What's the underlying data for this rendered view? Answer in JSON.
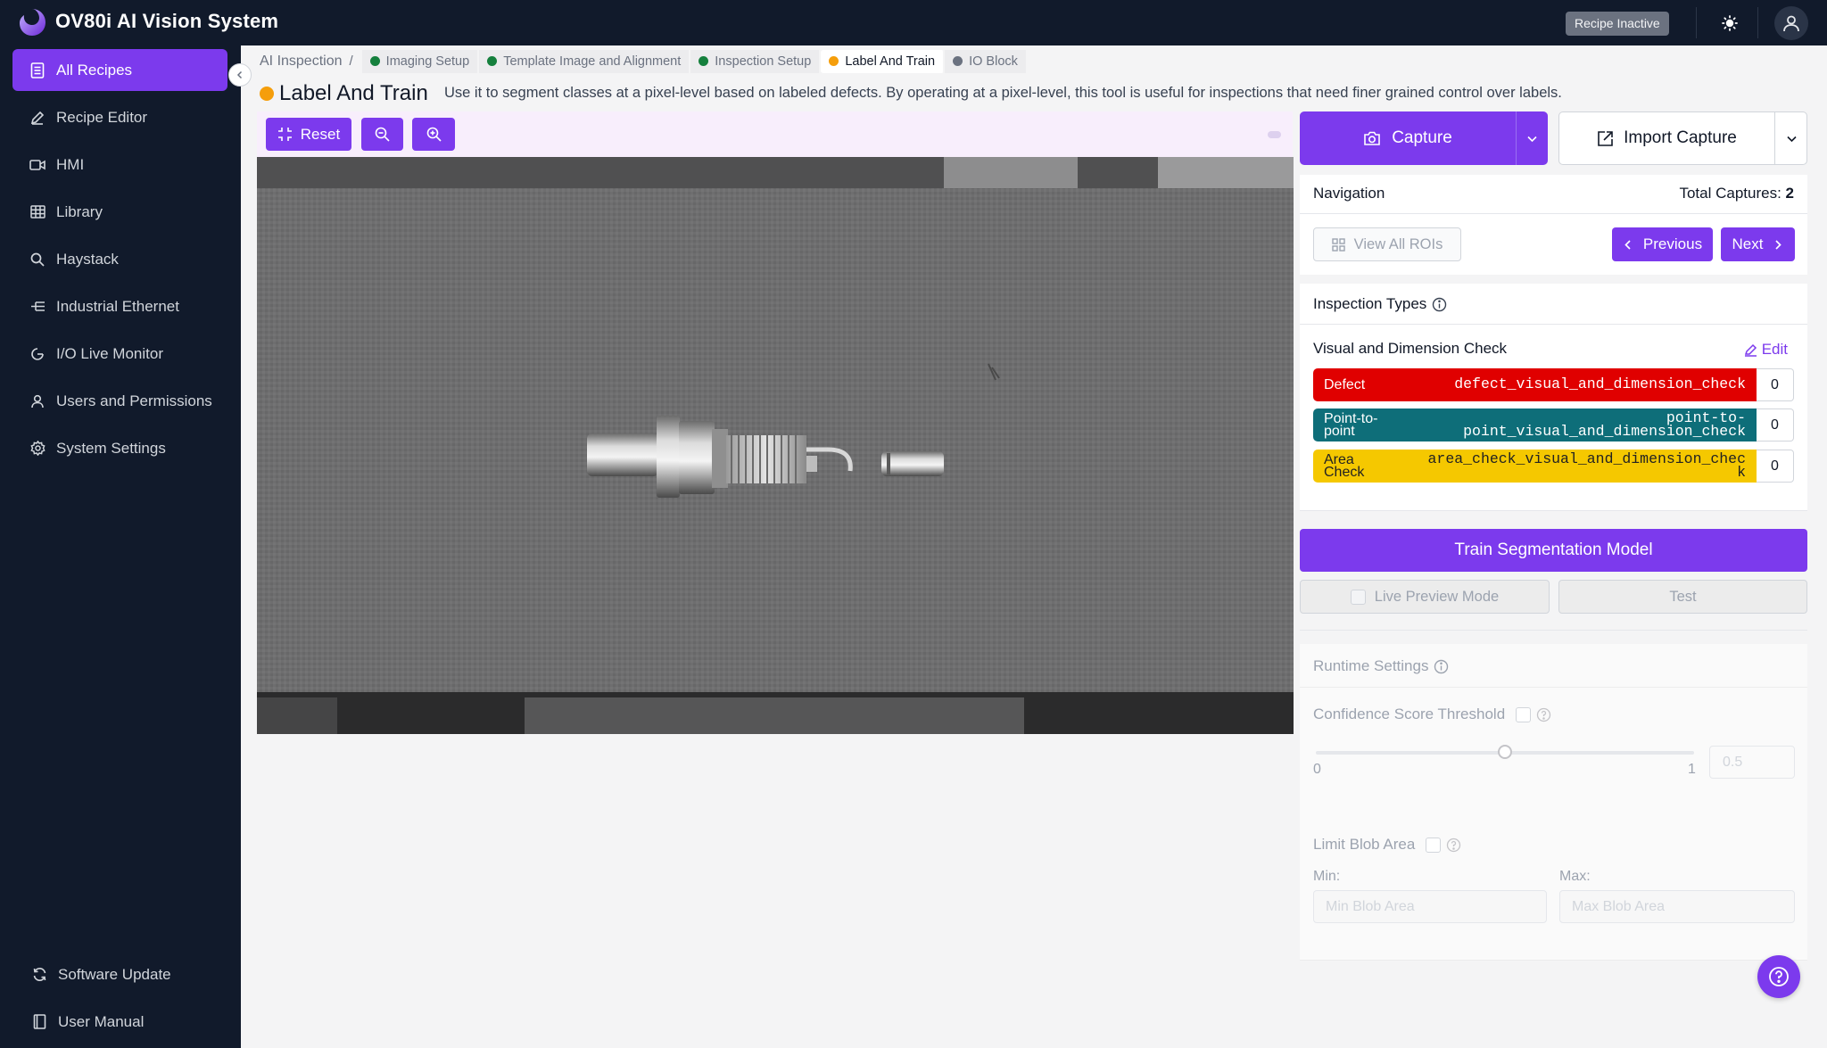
{
  "app": {
    "title": "OV80i AI Vision System",
    "recipe_status": "Recipe Inactive"
  },
  "sidebar": {
    "items": [
      {
        "label": "All Recipes",
        "icon": "document-icon",
        "active": true
      },
      {
        "label": "Recipe Editor",
        "icon": "pencil-icon"
      },
      {
        "label": "HMI",
        "icon": "video-icon"
      },
      {
        "label": "Library",
        "icon": "table-icon"
      },
      {
        "label": "Haystack",
        "icon": "search-icon"
      },
      {
        "label": "Industrial Ethernet",
        "icon": "network-icon"
      },
      {
        "label": "I/O Live Monitor",
        "icon": "monitor-icon"
      },
      {
        "label": "Users and Permissions",
        "icon": "user-icon"
      },
      {
        "label": "System Settings",
        "icon": "gear-icon"
      }
    ],
    "bottom_items": [
      {
        "label": "Software Update",
        "icon": "refresh-icon"
      },
      {
        "label": "User Manual",
        "icon": "book-icon"
      }
    ]
  },
  "breadcrumb": {
    "root": "AI Inspection",
    "separator": "/",
    "steps": [
      {
        "label": "Imaging Setup",
        "status_color": "#15803d"
      },
      {
        "label": "Template Image and Alignment",
        "status_color": "#15803d"
      },
      {
        "label": "Inspection Setup",
        "status_color": "#15803d"
      },
      {
        "label": "Label And Train",
        "status_color": "#f59e0b"
      },
      {
        "label": "IO Block",
        "status_color": "#6b7280"
      }
    ]
  },
  "page": {
    "title": "Label And Train",
    "description": "Use it to segment classes at a pixel-level based on labeled defects. By operating at a pixel-level, this tool is useful for inspections that need finer grained control over labels."
  },
  "image_toolbar": {
    "reset_label": "Reset"
  },
  "capture": {
    "capture_label": "Capture",
    "import_label": "Import Capture"
  },
  "navigation": {
    "title": "Navigation",
    "total_label": "Total Captures:",
    "total_value": "2",
    "view_all_label": "View All ROIs",
    "previous_label": "Previous",
    "next_label": "Next"
  },
  "inspection_types": {
    "title": "Inspection Types",
    "check_name": "Visual and Dimension Check",
    "edit_label": "Edit",
    "tags": [
      {
        "label_lines": [
          "Defect"
        ],
        "code_lines": [
          "defect_visual_and_dimension_check"
        ],
        "count": "0",
        "color": "#e00000",
        "text_color": "#ffffff"
      },
      {
        "label_lines": [
          "Point-to-",
          "point"
        ],
        "code_lines": [
          "point-to-",
          "point_visual_and_dimension_check"
        ],
        "count": "0",
        "color": "#0e6e79",
        "text_color": "#ffffff"
      },
      {
        "label_lines": [
          "Area",
          "Check"
        ],
        "code_lines": [
          "area_check_visual_and_dimension_chec",
          "k"
        ],
        "count": "0",
        "color": "#f5c800",
        "text_color": "#222222"
      }
    ]
  },
  "training": {
    "train_label": "Train Segmentation Model",
    "live_preview_label": "Live Preview Mode",
    "test_label": "Test"
  },
  "runtime": {
    "title": "Runtime Settings",
    "confidence_label": "Confidence Score Threshold",
    "slider_min": "0",
    "slider_max": "1",
    "confidence_value": 0.5,
    "confidence_input": "0.5",
    "blob_label": "Limit Blob Area",
    "min_label": "Min:",
    "max_label": "Max:",
    "min_placeholder": "Min Blob Area",
    "max_placeholder": "Max Blob Area"
  },
  "colors": {
    "accent": "#7c3aed",
    "topbar": "#111a2b"
  }
}
